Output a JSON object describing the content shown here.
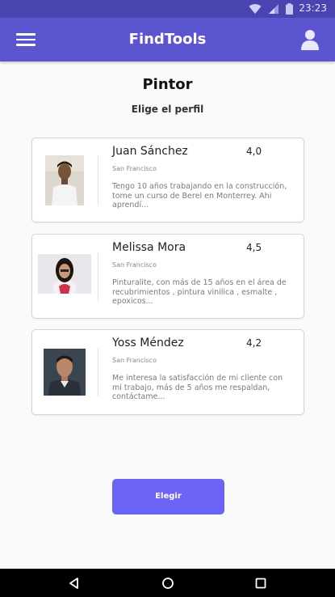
{
  "status_bar": {
    "time": "23:23",
    "icons": [
      "wifi-icon",
      "signal-icon",
      "battery-icon"
    ]
  },
  "app_bar": {
    "title": "FindTools",
    "menu_icon": "hamburger-menu-icon",
    "profile_icon": "user-profile-icon",
    "color": "#5b55cf"
  },
  "page": {
    "title": "Pintor",
    "subtitle": "Elige el perfil"
  },
  "profiles": [
    {
      "name": "Juan Sánchez",
      "rating": "4,0",
      "city": "San Francisco",
      "description": "Tengo 10 años trabajando en la construcción, tome un curso de Berel en Monterrey. Ahi aprendí..."
    },
    {
      "name": "Melissa Mora",
      "rating": "4,5",
      "city": "San Francisco",
      "description": "Pinturalite, con más de 15 años en el área de recubrimientos , pintura vinilica , esmalte , epoxicos..."
    },
    {
      "name": "Yoss Méndez",
      "rating": "4,2",
      "city": "San Francisco",
      "description": "Me interesa la satisfacción de mi cliente con mi trabajo, más de 5 años me respaldan, contáctame..."
    }
  ],
  "action": {
    "label": "Elegir",
    "color": "#6b63f5"
  },
  "nav_bar": {
    "icons": [
      "back-icon",
      "home-icon",
      "recents-icon"
    ]
  }
}
